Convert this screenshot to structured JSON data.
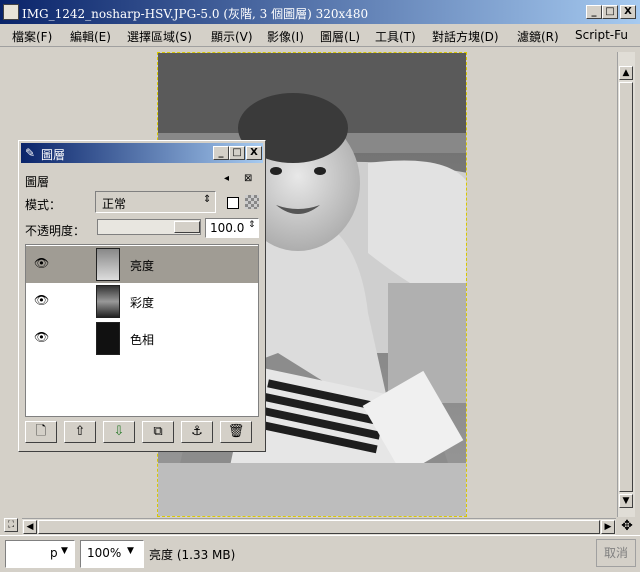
{
  "window": {
    "title": "IMG_1242_nosharp-HSV.JPG-5.0 (灰階, 3 個圖層) 320x480",
    "min": "_",
    "max": "□",
    "close": "X"
  },
  "menu": [
    "檔案(F)",
    "編輯(E)",
    "選擇區域(S)",
    "顯示(V)",
    "影像(I)",
    "圖層(L)",
    "工具(T)",
    "對話方塊(D)",
    "濾鏡(R)",
    "Script-Fu"
  ],
  "layers_dialog": {
    "title": "圖層",
    "heading": "圖層",
    "mode_label": "模式：",
    "mode_value": "正常",
    "opacity_label": "不透明度：",
    "opacity_value": "100.0",
    "opacity_fraction": 1.0,
    "layers": [
      {
        "name": "亮度",
        "selected": true
      },
      {
        "name": "彩度",
        "selected": false
      },
      {
        "name": "色相",
        "selected": false
      }
    ],
    "tool_icons": [
      "new-layer-icon",
      "raise-layer-icon",
      "lower-layer-icon",
      "duplicate-layer-icon",
      "anchor-layer-icon",
      "delete-layer-icon"
    ]
  },
  "status": {
    "unit": "p",
    "zoom": "100%",
    "info": "亮度 (1.33 MB)",
    "cancel": "取消"
  },
  "colors": {
    "title_start": "#0a246a",
    "title_end": "#a6caf0",
    "selection": "#a09c94",
    "selection_border": "#d8c800"
  }
}
